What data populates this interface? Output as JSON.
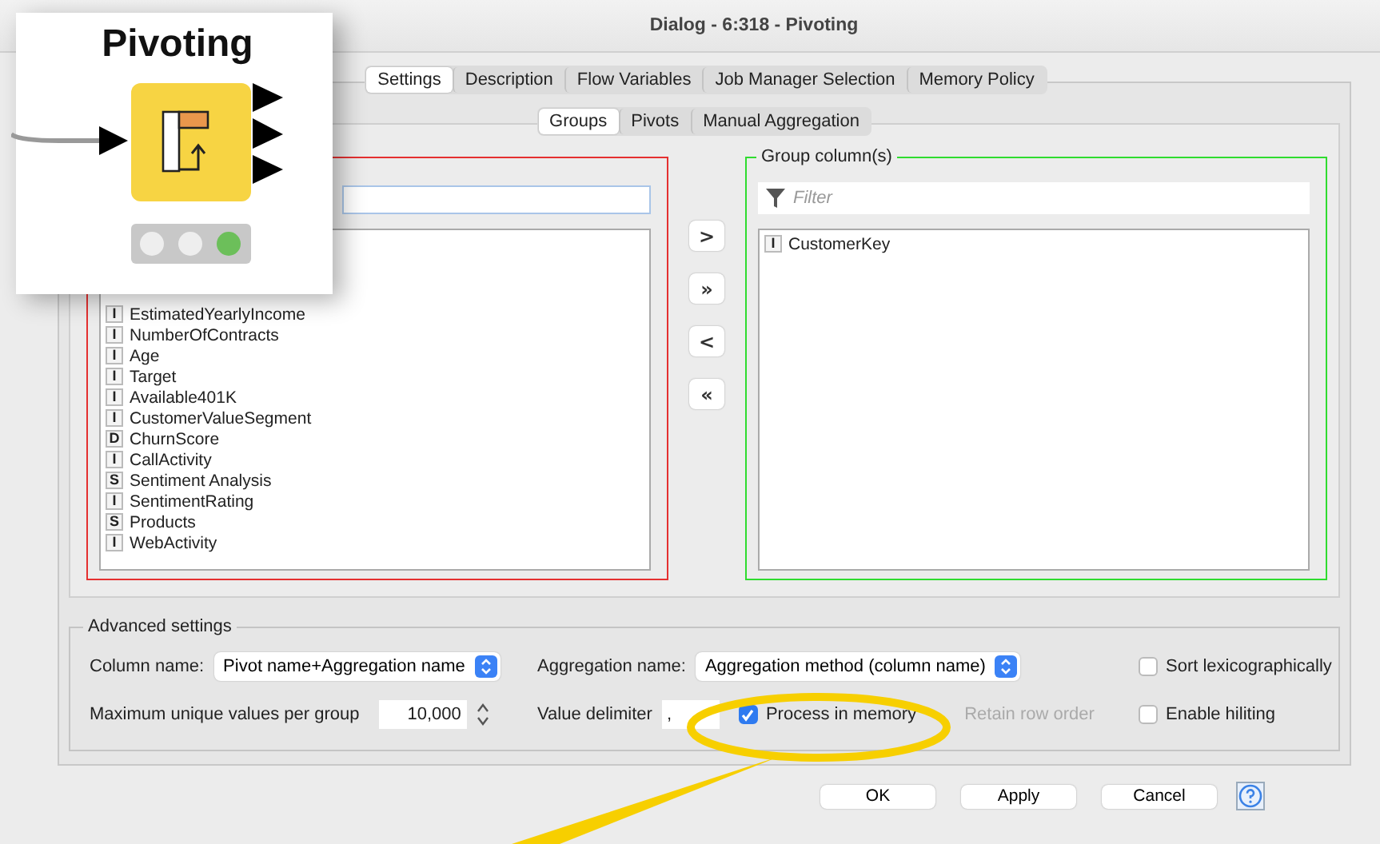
{
  "window": {
    "title": "Dialog - 6:318 - Pivoting"
  },
  "tabs": [
    {
      "label": "Settings",
      "selected": true
    },
    {
      "label": "Description",
      "selected": false
    },
    {
      "label": "Flow Variables",
      "selected": false
    },
    {
      "label": "Job Manager Selection",
      "selected": false
    },
    {
      "label": "Memory Policy",
      "selected": false
    }
  ],
  "subtabs": [
    {
      "label": "Groups",
      "selected": true
    },
    {
      "label": "Pivots",
      "selected": false
    },
    {
      "label": "Manual Aggregation",
      "selected": false
    }
  ],
  "available_columns": [
    {
      "type": "I",
      "name": "EstimatedYearlyIncome"
    },
    {
      "type": "I",
      "name": "NumberOfContracts"
    },
    {
      "type": "I",
      "name": "Age"
    },
    {
      "type": "I",
      "name": "Target"
    },
    {
      "type": "I",
      "name": "Available401K"
    },
    {
      "type": "I",
      "name": "CustomerValueSegment"
    },
    {
      "type": "D",
      "name": "ChurnScore"
    },
    {
      "type": "I",
      "name": "CallActivity"
    },
    {
      "type": "S",
      "name": "Sentiment Analysis"
    },
    {
      "type": "I",
      "name": "SentimentRating"
    },
    {
      "type": "S",
      "name": "Products"
    },
    {
      "type": "I",
      "name": "WebActivity"
    }
  ],
  "move_buttons": [
    ">",
    "»",
    "<",
    "«"
  ],
  "group_columns": {
    "title": "Group column(s)",
    "filter_placeholder": "Filter",
    "items": [
      {
        "type": "I",
        "name": "CustomerKey"
      }
    ]
  },
  "advanced_settings": {
    "title": "Advanced settings",
    "column_name": {
      "label": "Column name:",
      "value": "Pivot name+Aggregation name"
    },
    "aggregation_name": {
      "label": "Aggregation name:",
      "value": "Aggregation method (column name)"
    },
    "max_unique": {
      "label": "Maximum unique values per group",
      "value": "10,000"
    },
    "value_delimiter": {
      "label": "Value delimiter",
      "value": ","
    },
    "checkboxes": [
      {
        "label": "Process in memory",
        "checked": true,
        "disabled": false
      },
      {
        "label": "Retain row order",
        "disabled": true
      }
    ],
    "right_checkboxes": [
      {
        "label": "Sort lexicographically",
        "checked": false
      },
      {
        "label": "Enable hiliting",
        "checked": false
      }
    ]
  },
  "buttons": [
    "OK",
    "Apply",
    "Cancel"
  ],
  "node": {
    "title": "Pivoting"
  }
}
